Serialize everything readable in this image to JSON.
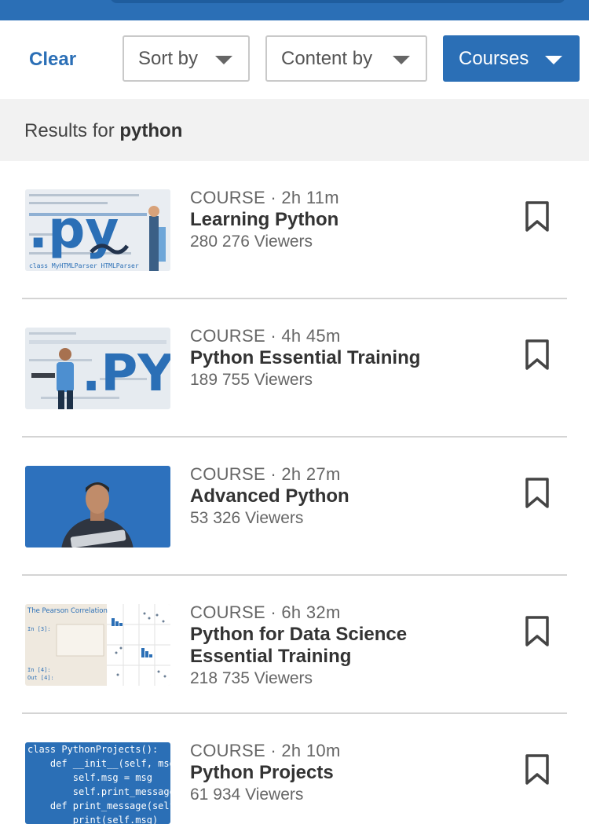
{
  "filters": {
    "clear_label": "Clear",
    "sort_label": "Sort by",
    "content_label": "Content by",
    "courses_label": "Courses"
  },
  "results": {
    "prefix": "Results for ",
    "query": "python"
  },
  "colors": {
    "accent": "#2b6fb6",
    "text": "#333333",
    "muted": "#666666",
    "divider": "#d4d4d4"
  },
  "courses": [
    {
      "kind": "COURSE",
      "duration": "2h 11m",
      "title_lines": [
        "Learning Python"
      ],
      "viewers": "280 276 Viewers",
      "thumb": "py-logo-light"
    },
    {
      "kind": "COURSE",
      "duration": "4h 45m",
      "title_lines": [
        "Python Essential Training"
      ],
      "viewers": "189 755 Viewers",
      "thumb": "py-caps-light"
    },
    {
      "kind": "COURSE",
      "duration": "2h 27m",
      "title_lines": [
        "Advanced Python"
      ],
      "viewers": "53 326 Viewers",
      "thumb": "instructor-photo"
    },
    {
      "kind": "COURSE",
      "duration": "6h 32m",
      "title_lines": [
        "Python for Data Science",
        "Essential Training"
      ],
      "viewers": "218 735 Viewers",
      "thumb": "notebook-charts"
    },
    {
      "kind": "COURSE",
      "duration": "2h 10m",
      "title_lines": [
        "Python Projects"
      ],
      "viewers": "61 934 Viewers",
      "thumb": "code-blue"
    }
  ],
  "thumb_text": {
    "py_small": ".py",
    "py_caps": ".PY",
    "code_line_class": "class MyHTMLParser HTMLParser",
    "pearson": "The Pearson Correlation",
    "in3": "In [3]:",
    "in4": "In [4]:",
    "out4": "Out [4]:",
    "code_blue": [
      "class PythonProjects():",
      "    def __init__(self, msg",
      "        self.msg = msg",
      "        self.print_message",
      "    def print_message(self",
      "        print(self.msg)"
    ]
  }
}
